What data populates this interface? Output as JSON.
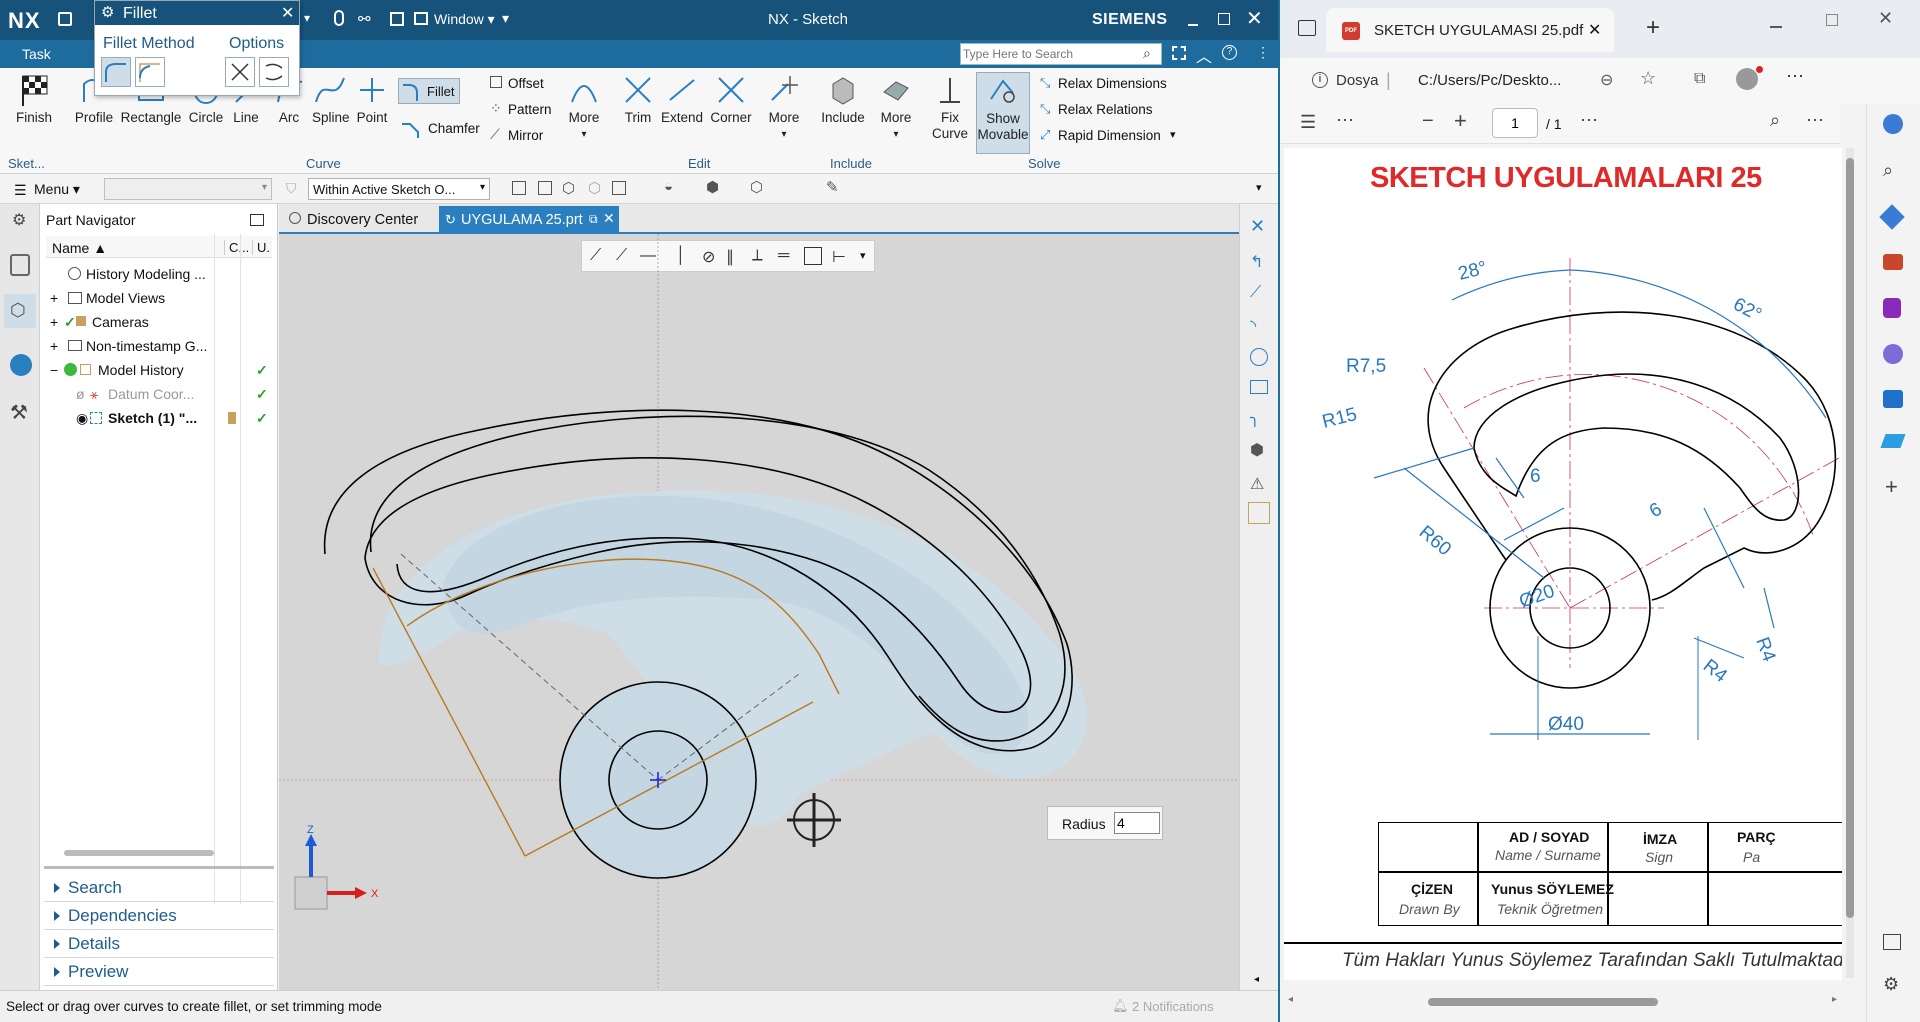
{
  "nx": {
    "logo": "NX",
    "window_menu": "Window",
    "title": "NX - Sketch",
    "brand": "SIEMENS",
    "task_tab": "Task",
    "search_placeholder": "Type Here to Search",
    "fillet_dialog": {
      "title": "Fillet",
      "method_label": "Fillet Method",
      "options_label": "Options"
    },
    "ribbon": {
      "finish": "Finish",
      "profile": "Profile",
      "rectangle": "Rectangle",
      "circle": "Circle",
      "line": "Line",
      "arc": "Arc",
      "spline": "Spline",
      "point": "Point",
      "fillet": "Fillet",
      "chamfer": "Chamfer",
      "offset": "Offset",
      "pattern": "Pattern",
      "mirror": "Mirror",
      "more": "More",
      "trim": "Trim",
      "extend": "Extend",
      "corner": "Corner",
      "include": "Include",
      "fix_curve_1": "Fix",
      "fix_curve_2": "Curve",
      "show_movable_1": "Show",
      "show_movable_2": "Movable",
      "relax_dimensions": "Relax Dimensions",
      "relax_relations": "Relax Relations",
      "rapid_dimension": "Rapid Dimension",
      "groups": {
        "sketch": "Sket...",
        "curve": "Curve",
        "edit": "Edit",
        "include": "Include",
        "solve": "Solve"
      }
    },
    "toolbar2": {
      "menu": "Menu",
      "filter": "Within Active Sketch O..."
    },
    "part_navigator": {
      "title": "Part Navigator",
      "col_name": "Name",
      "col_c": "C...",
      "col_u": "U.",
      "items": [
        {
          "label": "History Modeling ..."
        },
        {
          "label": "Model Views"
        },
        {
          "label": "Cameras"
        },
        {
          "label": "Non-timestamp G..."
        },
        {
          "label": "Model History"
        },
        {
          "label": "Datum Coor..."
        },
        {
          "label": "Sketch (1) \"..."
        }
      ],
      "accordion": [
        "Search",
        "Dependencies",
        "Details",
        "Preview"
      ]
    },
    "doc_tabs": {
      "discovery": "Discovery Center",
      "active": "UYGULAMA 25.prt"
    },
    "canvas": {
      "radius_label": "Radius",
      "radius_value": "4",
      "axis_z": "Z",
      "axis_x": "X"
    },
    "status": {
      "prompt": "Select or drag over curves to create fillet, or set trimming mode",
      "notifications": "2 Notifications"
    }
  },
  "browser": {
    "tab_title": "SKETCH UYGULAMASI 25.pdf",
    "address_label": "Dosya",
    "address": "C:/Users/Pc/Deskto...",
    "page_current": "1",
    "page_total": "/ 1",
    "pdf_icon_text": "PDF"
  },
  "pdf": {
    "title": "SKETCH UYGULAMALARI 25",
    "dims": {
      "a28": "28°",
      "a62": "62°",
      "r75": "R7,5",
      "r15": "R15",
      "d6a": "6",
      "d6b": "6",
      "r60": "R60",
      "d20": "Ø20",
      "r4a": "R4",
      "r4b": "R4",
      "d40": "Ø40"
    },
    "table": {
      "ad_soyad": "AD / SOYAD",
      "name_surname": "Name / Surname",
      "imza": "İMZA",
      "sign": "Sign",
      "parca": "PARÇ",
      "pa": "Pa",
      "cizen": "ÇİZEN",
      "drawn_by": "Drawn By",
      "person": "Yunus SÖYLEMEZ",
      "role": "Teknik Öğretmen"
    },
    "footer": "Tüm Hakları Yunus Söylemez Tarafından Saklı Tutulmaktadır"
  }
}
